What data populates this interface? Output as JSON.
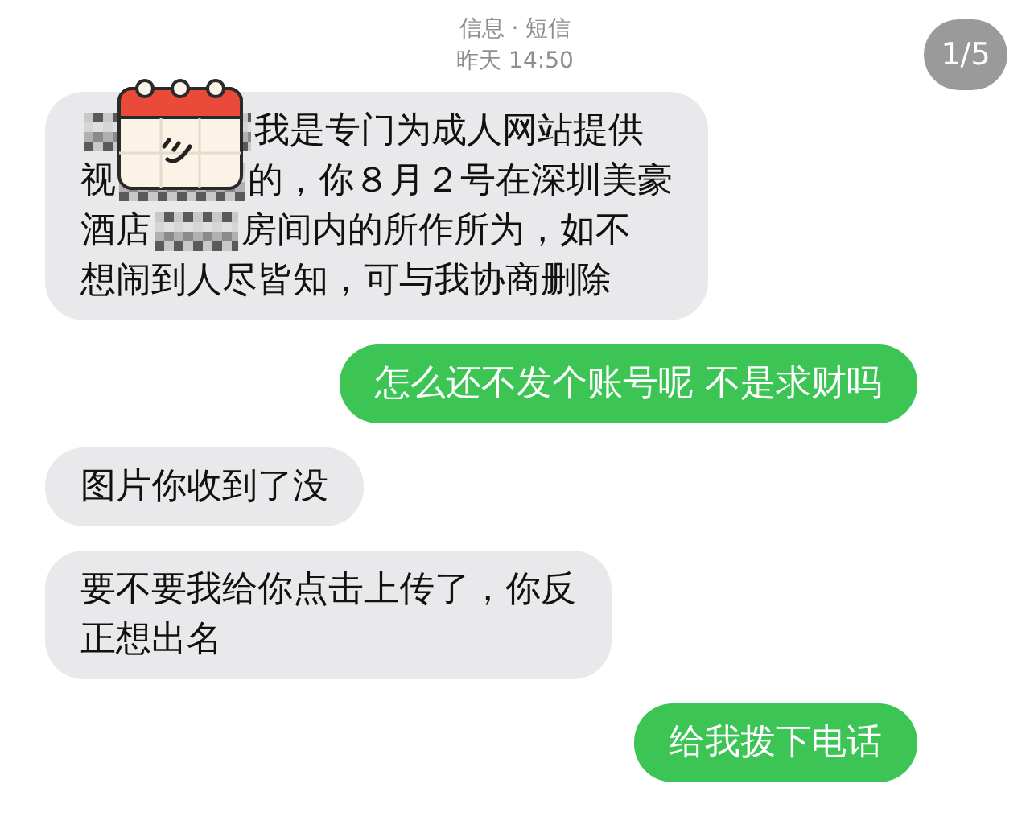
{
  "header": {
    "title": "信息 · 短信",
    "time": "昨天 14:50"
  },
  "page_counter": "1/5",
  "messages": [
    {
      "kind": "incoming",
      "sticker": true,
      "lines": [
        [
          {
            "kind": "redacted"
          },
          {
            "kind": "text",
            "text": "我是专门为成人网站提供"
          }
        ],
        [
          {
            "kind": "text",
            "text": "视"
          },
          {
            "kind": "redacted"
          },
          {
            "kind": "text",
            "text": "的，你８月２号在深圳美豪"
          }
        ],
        [
          {
            "kind": "text",
            "text": "酒店"
          },
          {
            "kind": "redacted"
          },
          {
            "kind": "text",
            "text": "房间内的所作所为，如不"
          }
        ],
        [
          {
            "kind": "text",
            "text": "想闹到人尽皆知，可与我协商删除"
          }
        ]
      ]
    },
    {
      "kind": "outgoing",
      "sticker": false,
      "lines": [
        [
          {
            "kind": "text",
            "text": "怎么还不发个账号呢 不是求财吗"
          }
        ]
      ]
    },
    {
      "kind": "incoming",
      "sticker": false,
      "lines": [
        [
          {
            "kind": "text",
            "text": "图片你收到了没"
          }
        ]
      ]
    },
    {
      "kind": "incoming",
      "sticker": false,
      "lines": [
        [
          {
            "kind": "text",
            "text": "要不要我给你点击上传了，你反"
          }
        ],
        [
          {
            "kind": "text",
            "text": "正想出名"
          }
        ]
      ]
    },
    {
      "kind": "outgoing",
      "sticker": false,
      "lines": [
        [
          {
            "kind": "text",
            "text": "给我拨下电话"
          }
        ]
      ]
    }
  ]
}
